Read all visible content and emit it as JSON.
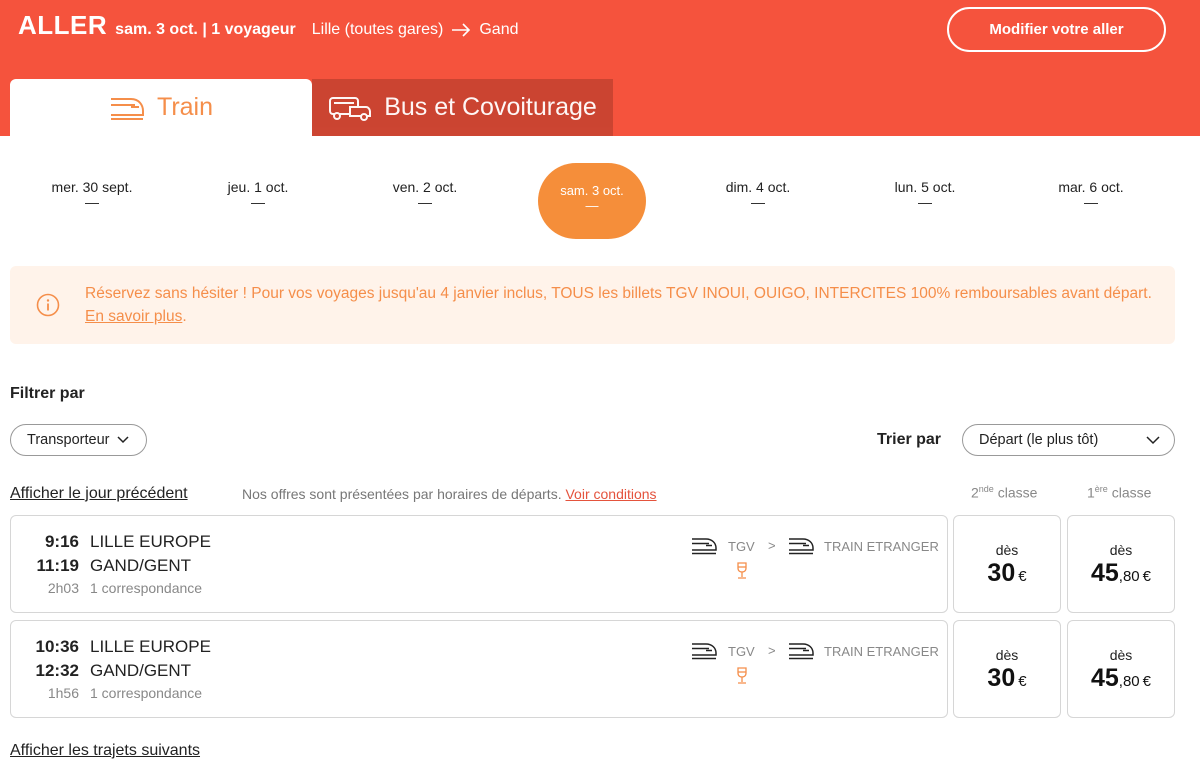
{
  "header": {
    "direction": "ALLER",
    "trip_info": "sam. 3 oct. | 1 voyageur",
    "origin": "Lille (toutes gares)",
    "destination": "Gand",
    "modify_label": "Modifier votre aller"
  },
  "tabs": [
    {
      "label": "Train",
      "icon": "train-icon",
      "active": true
    },
    {
      "label": "Bus et Covoiturage",
      "icon": "bus-car-icon",
      "active": false
    }
  ],
  "dates": [
    {
      "label": "mer. 30 sept.",
      "price": "—"
    },
    {
      "label": "jeu. 1 oct.",
      "price": "—"
    },
    {
      "label": "ven. 2 oct.",
      "price": "—"
    },
    {
      "label": "sam. 3 oct.",
      "price": "—",
      "active": true
    },
    {
      "label": "dim. 4 oct.",
      "price": "—"
    },
    {
      "label": "lun. 5 oct.",
      "price": "—"
    },
    {
      "label": "mar. 6 oct.",
      "price": "—"
    }
  ],
  "banner": {
    "icon": "info-icon",
    "text": "Réservez sans hésiter ! Pour vos voyages jusqu'au 4 janvier inclus, TOUS les billets TGV INOUI, OUIGO, INTERCITES 100% remboursables avant départ. ",
    "link": "En savoir plus",
    "suffix": "."
  },
  "filters": {
    "title": "Filtrer par",
    "carrier_label": "Transporteur",
    "sort_label": "Trier par",
    "sort_value": "Départ (le plus tôt)"
  },
  "list": {
    "prev_day": "Afficher le jour précédent",
    "note": "Nos offres sont présentées par horaires de départs. ",
    "note_link": "Voir conditions",
    "second_class": {
      "num": "2",
      "sup": "nde",
      "word": " classe"
    },
    "first_class": {
      "num": "1",
      "sup": "ère",
      "word": " classe"
    },
    "next_trips": "Afficher les trajets suivants"
  },
  "journeys": [
    {
      "dep_time": "9:16",
      "dep_station": "LILLE EUROPE",
      "arr_time": "11:19",
      "arr_station": "GAND/GENT",
      "duration": "2h03",
      "connections": "1 correspondance",
      "leg1": "TGV",
      "separator": ">",
      "leg2": "TRAIN ETRANGER",
      "price_2nd": {
        "from": "dès",
        "int": "30",
        "dec": "",
        "cur": "€"
      },
      "price_1st": {
        "from": "dès",
        "int": "45",
        "dec": ",80",
        "cur": "€"
      }
    },
    {
      "dep_time": "10:36",
      "dep_station": "LILLE EUROPE",
      "arr_time": "12:32",
      "arr_station": "GAND/GENT",
      "duration": "1h56",
      "connections": "1 correspondance",
      "leg1": "TGV",
      "separator": ">",
      "leg2": "TRAIN ETRANGER",
      "price_2nd": {
        "from": "dès",
        "int": "30",
        "dec": "",
        "cur": "€"
      },
      "price_1st": {
        "from": "dès",
        "int": "45",
        "dec": ",80",
        "cur": "€"
      }
    }
  ],
  "colors": {
    "brand": "#f5533d",
    "accent": "#f58e3a",
    "banner_bg": "#fff3ea"
  }
}
